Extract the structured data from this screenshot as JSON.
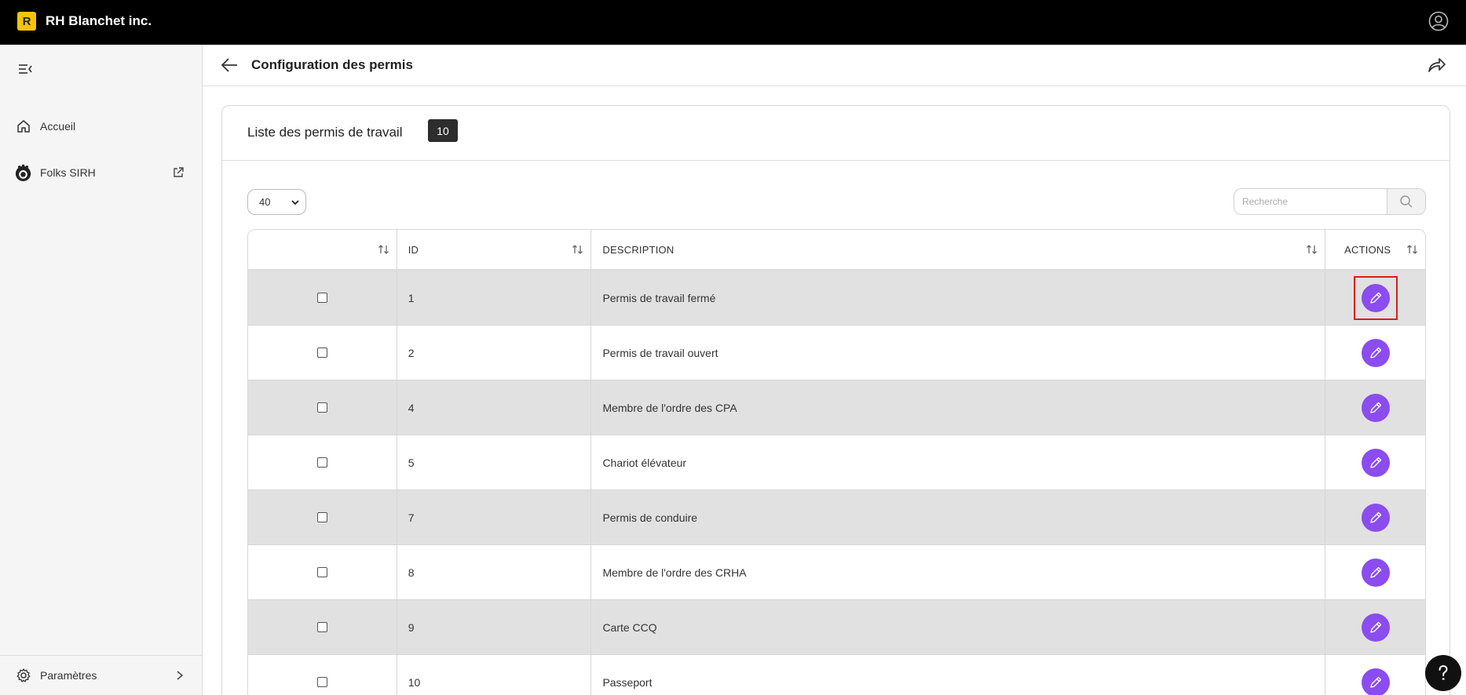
{
  "app": {
    "logo_letter": "R",
    "company_name": "RH Blanchet inc."
  },
  "sidebar": {
    "items": [
      {
        "label": "Accueil",
        "icon": "home-icon"
      },
      {
        "label": "Folks SIRH",
        "icon": "folks-icon",
        "external": true
      }
    ],
    "settings_label": "Paramètres"
  },
  "header": {
    "title": "Configuration des permis"
  },
  "card": {
    "title": "Liste des permis de travail",
    "count": "10"
  },
  "controls": {
    "page_size": "40",
    "search_placeholder": "Recherche"
  },
  "table": {
    "columns": [
      "",
      "ID",
      "DESCRIPTION",
      "ACTIONS"
    ],
    "rows": [
      {
        "id": "1",
        "description": "Permis de travail fermé"
      },
      {
        "id": "2",
        "description": "Permis de travail ouvert"
      },
      {
        "id": "4",
        "description": "Membre de l'ordre des CPA"
      },
      {
        "id": "5",
        "description": "Chariot élévateur"
      },
      {
        "id": "7",
        "description": "Permis de conduire"
      },
      {
        "id": "8",
        "description": "Membre de l'ordre des CRHA"
      },
      {
        "id": "9",
        "description": "Carte CCQ"
      },
      {
        "id": "10",
        "description": "Passeport"
      }
    ]
  },
  "colors": {
    "topbar": "#000000",
    "logo": "#f5c400",
    "action_button": "#8b4cf0",
    "highlight_box": "#e01b1b",
    "row_alt": "#e1e1e1"
  }
}
